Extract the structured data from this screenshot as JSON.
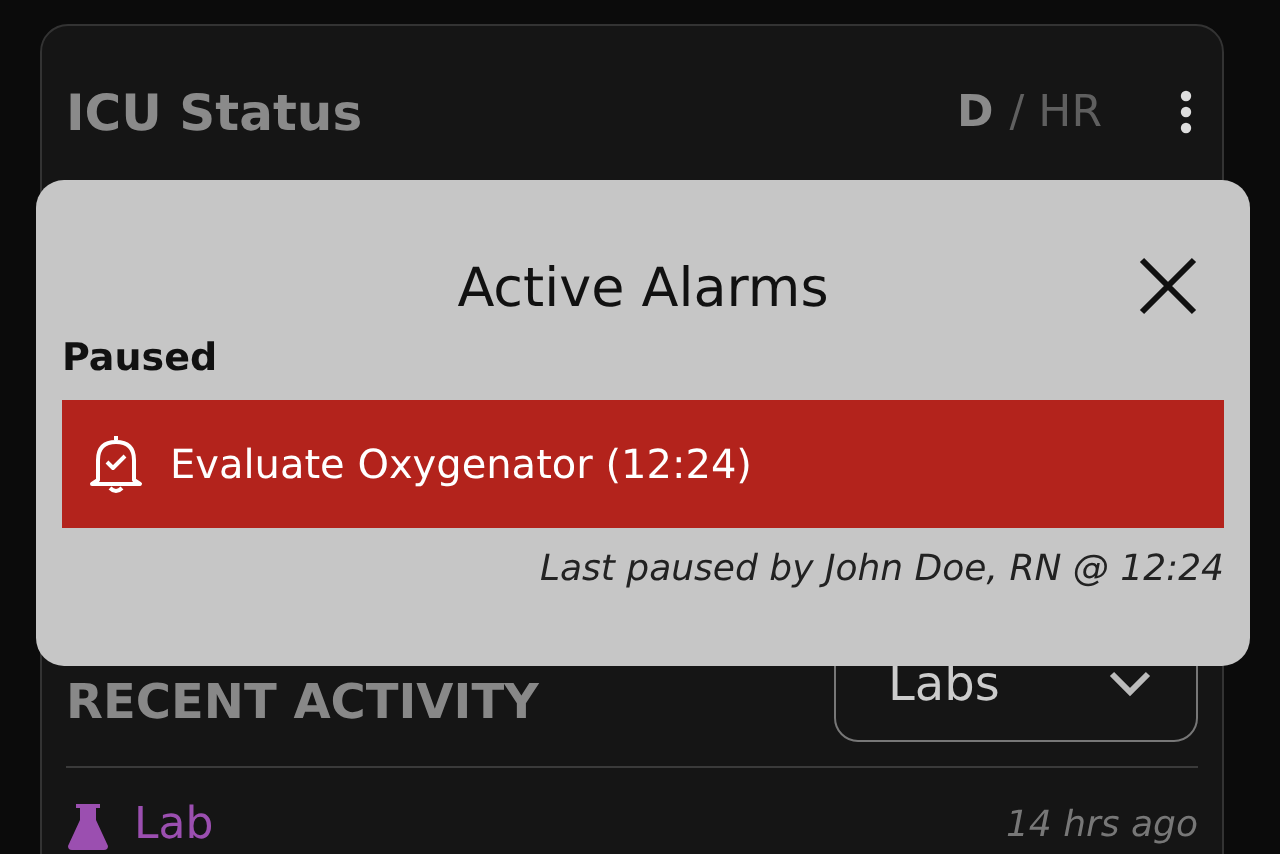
{
  "card": {
    "title": "ICU Status",
    "view_toggle": [
      {
        "label": "D",
        "selected": true
      },
      {
        "label": "/ HR",
        "selected": false
      }
    ]
  },
  "recent_activity": {
    "heading": "RECENT ACTIVITY",
    "filter": {
      "value": "Labs"
    },
    "items": [
      {
        "kind": "lab",
        "label": "Lab",
        "time": "14 hrs ago"
      }
    ]
  },
  "modal": {
    "title": "Active Alarms",
    "section": "Paused",
    "alarms": [
      {
        "text": "Evaluate Oxygenator (12:24)"
      }
    ],
    "note": "Last paused by John Doe, RN @ 12:24"
  }
}
